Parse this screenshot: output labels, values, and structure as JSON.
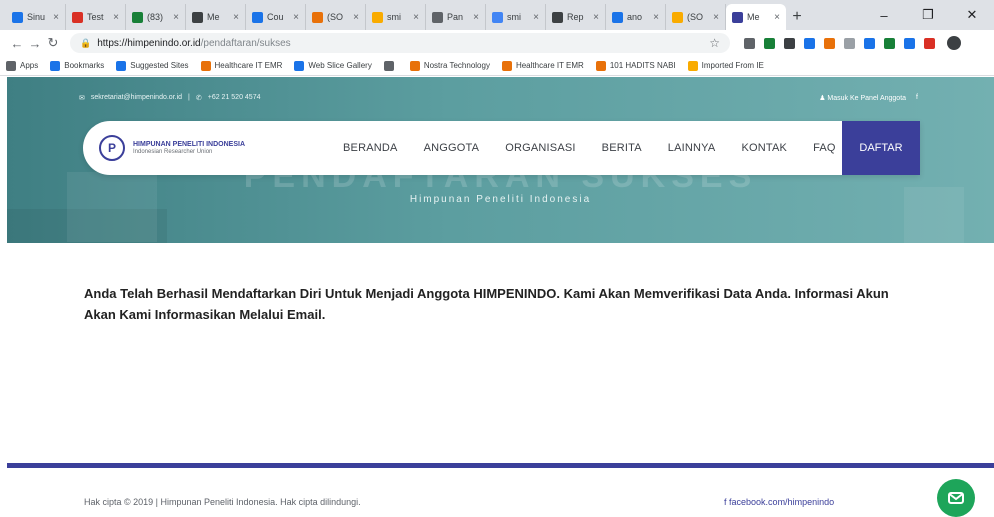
{
  "browser": {
    "tabs": [
      {
        "label": "Sinu",
        "color": "#1a73e8"
      },
      {
        "label": "Test",
        "color": "#d93025"
      },
      {
        "label": "(83)",
        "color": "#188038"
      },
      {
        "label": "Me",
        "color": "#3c4043"
      },
      {
        "label": "Cou",
        "color": "#1a73e8"
      },
      {
        "label": "(SO",
        "color": "#e8710a"
      },
      {
        "label": "smi",
        "color": "#f9ab00"
      },
      {
        "label": "Pan",
        "color": "#5f6368"
      },
      {
        "label": "smi",
        "color": "#4285f4"
      },
      {
        "label": "Rep",
        "color": "#3c4043"
      },
      {
        "label": "ano",
        "color": "#1a73e8"
      },
      {
        "label": "(SO",
        "color": "#f9ab00"
      },
      {
        "label": "Me",
        "color": "#3b3f9a"
      }
    ],
    "new_tab_symbol": "+",
    "window_controls": [
      "–",
      "❐",
      "✕"
    ],
    "url_domain": "https://himpenindo.or.id",
    "url_path": "/pendaftaran/sukses",
    "bookmarks": [
      {
        "label": "Apps",
        "color": "#5f6368"
      },
      {
        "label": "Bookmarks",
        "color": "#1a73e8"
      },
      {
        "label": "Suggested Sites",
        "color": "#1a73e8"
      },
      {
        "label": "Healthcare IT EMR",
        "color": "#e8710a"
      },
      {
        "label": "Web Slice Gallery",
        "color": "#1a73e8"
      },
      {
        "label": "",
        "color": "#5f6368"
      },
      {
        "label": "Nostra Technology",
        "color": "#e8710a"
      },
      {
        "label": "Healthcare IT EMR",
        "color": "#e8710a"
      },
      {
        "label": "101 HADITS NABI",
        "color": "#e8710a"
      },
      {
        "label": "Imported From IE",
        "color": "#f9ab00"
      }
    ],
    "extension_colors": [
      "#5f6368",
      "#188038",
      "#3c4043",
      "#1a73e8",
      "#e8710a",
      "#9aa0a6",
      "#1a73e8",
      "#188038",
      "#1a73e8",
      "#d93025"
    ]
  },
  "site": {
    "top_email": "sekretariat@himpenindo.or.id",
    "top_phone": "+62 21 520 4574",
    "member_panel": "Masuk Ke Panel Anggota",
    "logo_line1": "HIMPUNAN PENELITI INDONESIA",
    "logo_line2": "Indonesian Researcher Union",
    "menu": [
      "BERANDA",
      "ANGGOTA",
      "ORGANISASI",
      "BERITA",
      "LAINNYA",
      "KONTAK",
      "FAQ"
    ],
    "register": "DAFTAR",
    "hero_title": "PENDAFTARAN SUKSES",
    "hero_subtitle": "Himpunan Peneliti Indonesia"
  },
  "content": {
    "message": "Anda Telah Berhasil Mendaftarkan Diri Untuk Menjadi Anggota HIMPENINDO. Kami Akan Memverifikasi Data Anda. Informasi Akun Akan Kami Informasikan Melalui Email."
  },
  "footer": {
    "copyright": "Hak cipta © 2019 | Himpunan Peneliti Indonesia. Hak cipta dilindungi.",
    "facebook": "facebook.com/himpenindo"
  },
  "colors": {
    "brand": "#3b3f9a",
    "hero": "#5c9ea0",
    "chat": "#1ea55a"
  },
  "icons": [
    "back-icon",
    "forward-icon",
    "reload-icon",
    "lock-icon",
    "star-icon",
    "mail-icon",
    "phone-icon",
    "user-icon",
    "facebook-icon",
    "chat-icon"
  ]
}
